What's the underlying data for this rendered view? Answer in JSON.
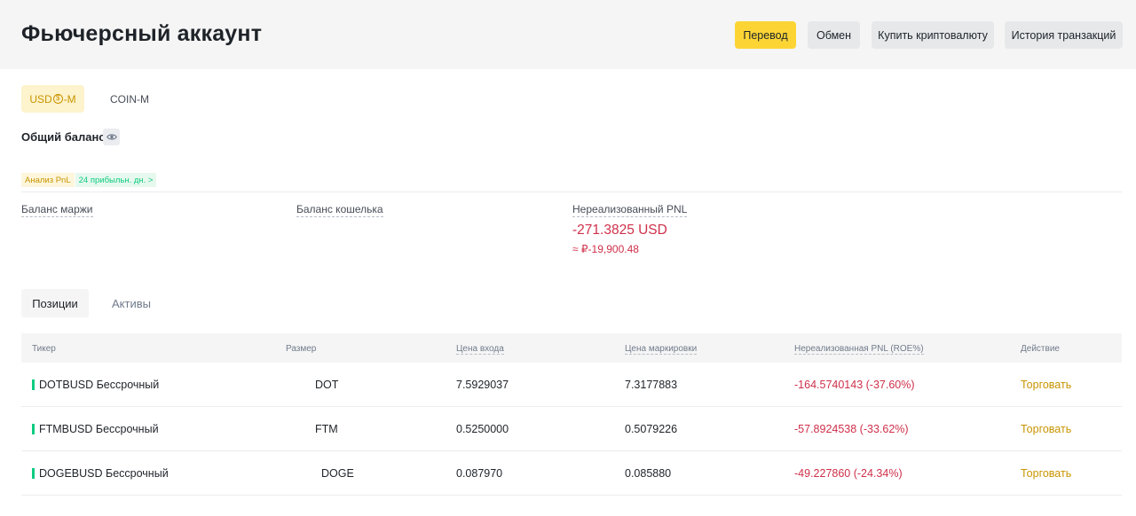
{
  "header": {
    "title": "Фьючерсный аккаунт",
    "buttons": {
      "transfer": "Перевод",
      "exchange": "Обмен",
      "buy_crypto": "Купить криптовалюту",
      "history": "История транзакций"
    }
  },
  "margin_tabs": {
    "usd_m": {
      "pre": "USD",
      "coin_glyph": "$",
      "post": "-M"
    },
    "coin_m": "COIN-M"
  },
  "balance": {
    "label": "Общий баланс",
    "eye_icon": "eye-icon"
  },
  "pnl_tag": {
    "analysis": "Анализ PnL",
    "profit_days": "24 прибыльн. дн. >"
  },
  "stats": {
    "margin_balance": "Баланс маржи",
    "wallet_balance": "Баланс кошелька",
    "unrealized_pnl": "Нереализованный PNL",
    "unrealized_value": "-271.3825 USD",
    "unrealized_approx": "≈ ₽-19,900.48"
  },
  "positions_tabs": {
    "positions": "Позиции",
    "assets": "Активы"
  },
  "table": {
    "headers": {
      "ticker": "Тикер",
      "size": "Размер",
      "entry": "Цена входа",
      "mark": "Цена маркировки",
      "pnl": "Нереализованная PNL (ROE%)",
      "action": "Действие"
    },
    "rows": [
      {
        "ticker": "DOTBUSD Бессрочный",
        "size": "DOT",
        "entry": "7.5929037",
        "mark": "7.3177883",
        "pnl": "-164.5740143 (-37.60%)",
        "action": "Торговать"
      },
      {
        "ticker": "FTMBUSD Бессрочный",
        "size": "FTM",
        "entry": "0.5250000",
        "mark": "0.5079226",
        "pnl": "-57.8924538 (-33.62%)",
        "action": "Торговать"
      },
      {
        "ticker": "DOGEBUSD Бессрочный",
        "size": "DOGE",
        "entry": "0.087970",
        "mark": "0.085880",
        "pnl": "-49.227860 (-24.34%)",
        "action": "Торговать"
      }
    ]
  },
  "colors": {
    "accent": "#fcd535",
    "negative": "#cf304a",
    "positive": "#0ecb81",
    "link": "#c99400"
  }
}
